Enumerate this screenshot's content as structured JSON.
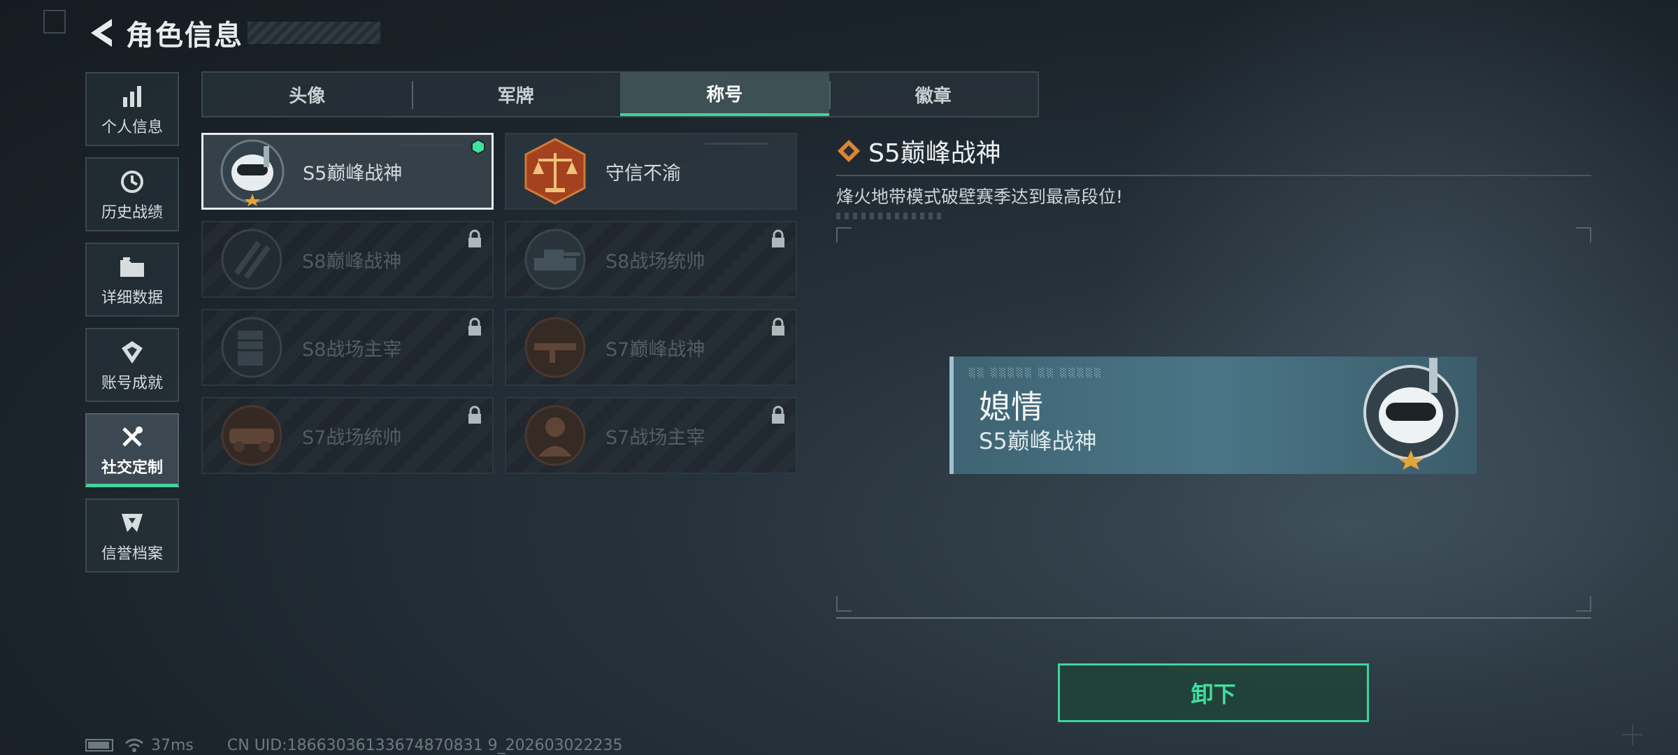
{
  "header": {
    "title": "角色信息"
  },
  "sidebar": {
    "items": [
      {
        "label": "个人信息",
        "icon": "bar-chart-icon"
      },
      {
        "label": "历史战绩",
        "icon": "history-icon"
      },
      {
        "label": "详细数据",
        "icon": "folder-icon"
      },
      {
        "label": "账号成就",
        "icon": "medal-icon"
      },
      {
        "label": "社交定制",
        "icon": "tools-icon",
        "active": true
      },
      {
        "label": "信誉档案",
        "icon": "shield-icon"
      }
    ]
  },
  "tabs": [
    {
      "label": "头像"
    },
    {
      "label": "军牌"
    },
    {
      "label": "称号",
      "active": true
    },
    {
      "label": "徽章"
    }
  ],
  "titles": [
    {
      "name": "S5巅峰战神",
      "state": "selected-equipped"
    },
    {
      "name": "守信不渝",
      "state": "unlocked"
    },
    {
      "name": "S8巅峰战神",
      "state": "locked"
    },
    {
      "name": "S8战场统帅",
      "state": "locked"
    },
    {
      "name": "S8战场主宰",
      "state": "locked"
    },
    {
      "name": "S7巅峰战神",
      "state": "locked"
    },
    {
      "name": "S7战场统帅",
      "state": "locked"
    },
    {
      "name": "S7战场主宰",
      "state": "locked"
    }
  ],
  "detail": {
    "title": "S5巅峰战神",
    "description": "烽火地带模式破壁赛季达到最高段位!"
  },
  "preview": {
    "player_name": "媳情",
    "title": "S5巅峰战神"
  },
  "actions": {
    "unload_label": "卸下"
  },
  "status": {
    "ping": "37ms",
    "uid": "CN UID:18663036133674870831 9_202603022235"
  },
  "colors": {
    "accent": "#3fd39a",
    "background": "#1b232a"
  }
}
